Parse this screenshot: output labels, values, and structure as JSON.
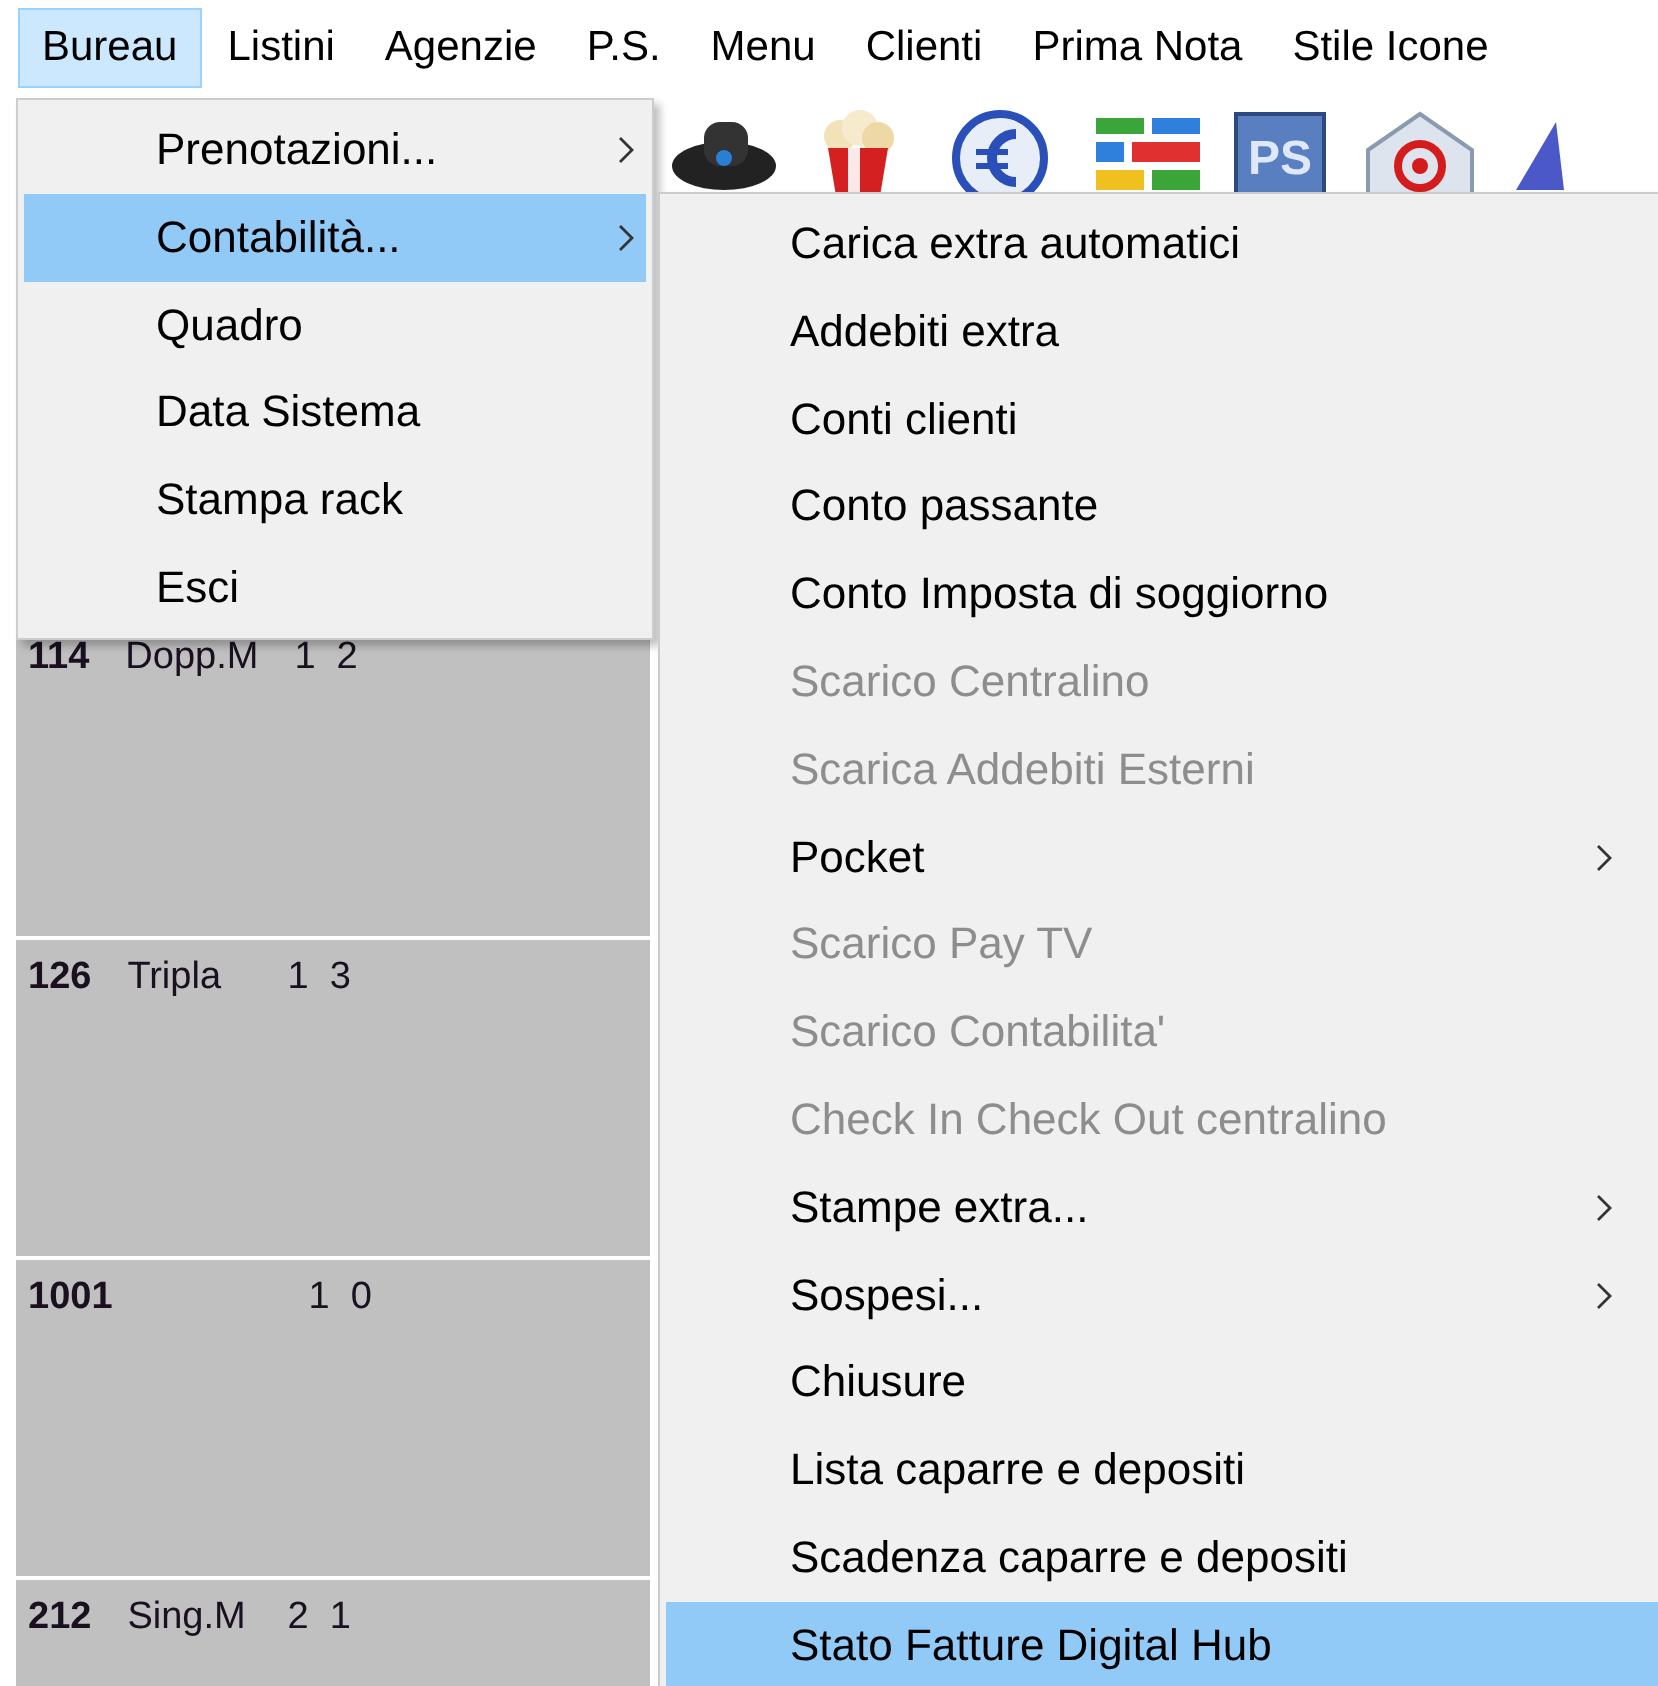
{
  "menubar": [
    {
      "label": "Bureau",
      "selected": true
    },
    {
      "label": "Listini",
      "selected": false
    },
    {
      "label": "Agenzie",
      "selected": false
    },
    {
      "label": "P.S.",
      "selected": false
    },
    {
      "label": "Menu",
      "selected": false
    },
    {
      "label": "Clienti",
      "selected": false
    },
    {
      "label": "Prima Nota",
      "selected": false
    },
    {
      "label": "Stile Icone",
      "selected": false
    }
  ],
  "toolbar": {
    "ps_icon_text": "PS"
  },
  "rooms": [
    {
      "number": "114",
      "type": "Dopp.M",
      "counts": "1  2"
    },
    {
      "number": "126",
      "type": "Tripla",
      "counts": "1  3"
    },
    {
      "number": "1001",
      "counts": "1  0"
    },
    {
      "number": "212",
      "type": "Sing.M",
      "counts": "2  1"
    }
  ],
  "menu": [
    {
      "label": "Prenotazioni...",
      "submenu": true,
      "selected": false,
      "disabled": false
    },
    {
      "label": "Contabilità...",
      "submenu": true,
      "selected": true,
      "disabled": false
    },
    {
      "label": "Quadro",
      "submenu": false,
      "selected": false,
      "disabled": false
    },
    {
      "label": "Data Sistema",
      "submenu": false,
      "selected": false,
      "disabled": false
    },
    {
      "label": "Stampa rack",
      "submenu": false,
      "selected": false,
      "disabled": false
    },
    {
      "label": "Esci",
      "submenu": false,
      "selected": false,
      "disabled": false
    }
  ],
  "submenu": [
    {
      "label": "Carica extra automatici",
      "submenu": false,
      "selected": false,
      "disabled": false
    },
    {
      "label": "Addebiti extra",
      "submenu": false,
      "selected": false,
      "disabled": false
    },
    {
      "label": "Conti clienti",
      "submenu": false,
      "selected": false,
      "disabled": false
    },
    {
      "label": "Conto passante",
      "submenu": false,
      "selected": false,
      "disabled": false
    },
    {
      "label": "Conto Imposta di soggiorno",
      "submenu": false,
      "selected": false,
      "disabled": false
    },
    {
      "label": "Scarico Centralino",
      "submenu": false,
      "selected": false,
      "disabled": true
    },
    {
      "label": "Scarica Addebiti Esterni",
      "submenu": false,
      "selected": false,
      "disabled": true
    },
    {
      "label": "Pocket",
      "submenu": true,
      "selected": false,
      "disabled": false
    },
    {
      "label": "Scarico Pay TV",
      "submenu": false,
      "selected": false,
      "disabled": true
    },
    {
      "label": "Scarico Contabilita'",
      "submenu": false,
      "selected": false,
      "disabled": true
    },
    {
      "label": "Check In Check Out centralino",
      "submenu": false,
      "selected": false,
      "disabled": true
    },
    {
      "label": "Stampe extra...",
      "submenu": true,
      "selected": false,
      "disabled": false
    },
    {
      "label": "Sospesi...",
      "submenu": true,
      "selected": false,
      "disabled": false
    },
    {
      "label": "Chiusure",
      "submenu": false,
      "selected": false,
      "disabled": false
    },
    {
      "label": "Lista caparre e depositi",
      "submenu": false,
      "selected": false,
      "disabled": false
    },
    {
      "label": "Scadenza caparre e depositi",
      "submenu": false,
      "selected": false,
      "disabled": false
    },
    {
      "label": "Stato Fatture Digital Hub",
      "submenu": false,
      "selected": true,
      "disabled": false
    }
  ]
}
